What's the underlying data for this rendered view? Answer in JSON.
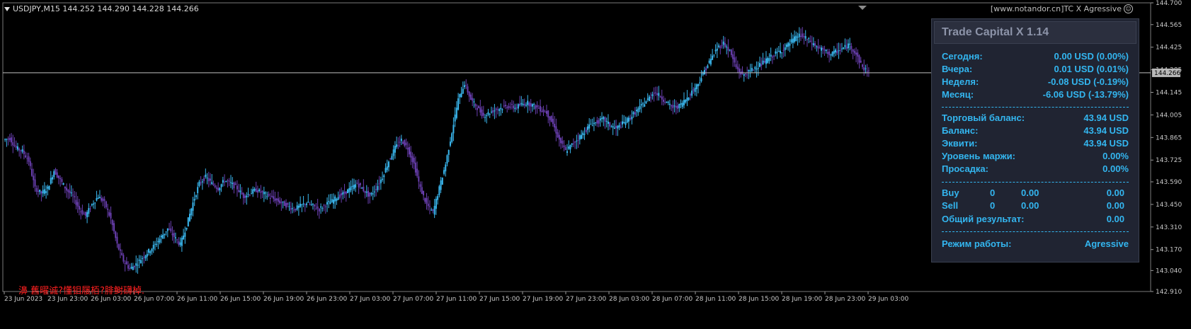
{
  "chart": {
    "symbol_label": "USDJPY,M15  144.252 144.290 144.228 144.266",
    "source_label": "[www.notandor.cn]TC X Agressive",
    "red_note": "濞 舊曜诚?懂钼屦栢?腓鲥礴棹.",
    "current_price_label": "144.266",
    "price_levels": [
      "144.700",
      "144.565",
      "144.425",
      "144.285",
      "144.145",
      "144.005",
      "143.865",
      "143.725",
      "143.590",
      "143.450",
      "143.310",
      "143.170",
      "143.040",
      "142.910"
    ],
    "time_labels": [
      "23 Jun 2023",
      "23 Jun 23:00",
      "26 Jun 03:00",
      "26 Jun 07:00",
      "26 Jun 11:00",
      "26 Jun 15:00",
      "26 Jun 19:00",
      "26 Jun 23:00",
      "27 Jun 03:00",
      "27 Jun 07:00",
      "27 Jun 11:00",
      "27 Jun 15:00",
      "27 Jun 19:00",
      "27 Jun 23:00",
      "28 Jun 03:00",
      "28 Jun 07:00",
      "28 Jun 11:00",
      "28 Jun 15:00",
      "28 Jun 19:00",
      "28 Jun 23:00",
      "29 Jun 03:00"
    ],
    "colors": {
      "bull": "#3ab8f0",
      "bear": "#6a3fb0",
      "grid_line": "#c0c0c0",
      "axis_text": "#c8c8c8"
    },
    "price_series": [
      143.85,
      143.86,
      143.8,
      143.78,
      143.72,
      143.55,
      143.52,
      143.55,
      143.66,
      143.6,
      143.54,
      143.5,
      143.42,
      143.38,
      143.45,
      143.5,
      143.46,
      143.36,
      143.2,
      143.1,
      143.05,
      143.08,
      143.12,
      143.16,
      143.2,
      143.25,
      143.3,
      143.25,
      143.2,
      143.32,
      143.46,
      143.58,
      143.62,
      143.58,
      143.55,
      143.6,
      143.58,
      143.55,
      143.5,
      143.52,
      143.54,
      143.52,
      143.5,
      143.48,
      143.46,
      143.44,
      143.42,
      143.44,
      143.46,
      143.44,
      143.42,
      143.45,
      143.47,
      143.5,
      143.52,
      143.55,
      143.58,
      143.54,
      143.5,
      143.55,
      143.62,
      143.72,
      143.8,
      143.85,
      143.8,
      143.7,
      143.55,
      143.45,
      143.4,
      143.55,
      143.7,
      143.9,
      144.1,
      144.2,
      144.1,
      144.05,
      144.0,
      144.02,
      144.04,
      144.05,
      144.06,
      144.05,
      144.07,
      144.08,
      144.06,
      144.04,
      144.02,
      143.95,
      143.85,
      143.78,
      143.82,
      143.86,
      143.9,
      143.95,
      143.96,
      143.98,
      143.94,
      143.92,
      143.95,
      143.98,
      144.02,
      144.06,
      144.1,
      144.15,
      144.12,
      144.08,
      144.05,
      144.06,
      144.1,
      144.15,
      144.2,
      144.28,
      144.35,
      144.42,
      144.45,
      144.4,
      144.3,
      144.25,
      144.27,
      144.3,
      144.32,
      144.35,
      144.38,
      144.4,
      144.43,
      144.47,
      144.5,
      144.48,
      144.45,
      144.42,
      144.4,
      144.38,
      144.4,
      144.42,
      144.44,
      144.38,
      144.3,
      144.27
    ],
    "price_min": 142.91,
    "price_max": 144.7
  },
  "panel": {
    "title": "Trade Capital X 1.14",
    "rows_period": [
      {
        "label": "Сегодня:",
        "value": "0.00 USD (0.00%)"
      },
      {
        "label": "Вчера:",
        "value": "0.01 USD (0.01%)"
      },
      {
        "label": "Неделя:",
        "value": "-0.08 USD (-0.19%)"
      },
      {
        "label": "Месяц:",
        "value": "-6.06 USD (-13.79%)"
      }
    ],
    "rows_balance": [
      {
        "label": "Торговый баланс:",
        "value": "43.94 USD"
      },
      {
        "label": "Баланс:",
        "value": "43.94 USD"
      },
      {
        "label": "Эквити:",
        "value": "43.94 USD"
      },
      {
        "label": "Уровень маржи:",
        "value": "0.00%"
      },
      {
        "label": "Просадка:",
        "value": "0.00%"
      }
    ],
    "orders": [
      {
        "side": "Buy",
        "count": "0",
        "lots": "0.00",
        "profit": "0.00"
      },
      {
        "side": "Sell",
        "count": "0",
        "lots": "0.00",
        "profit": "0.00"
      }
    ],
    "total_label": "Общий результат:",
    "total_value": "0.00",
    "mode_label": "Режим работы:",
    "mode_value": "Agressive"
  }
}
